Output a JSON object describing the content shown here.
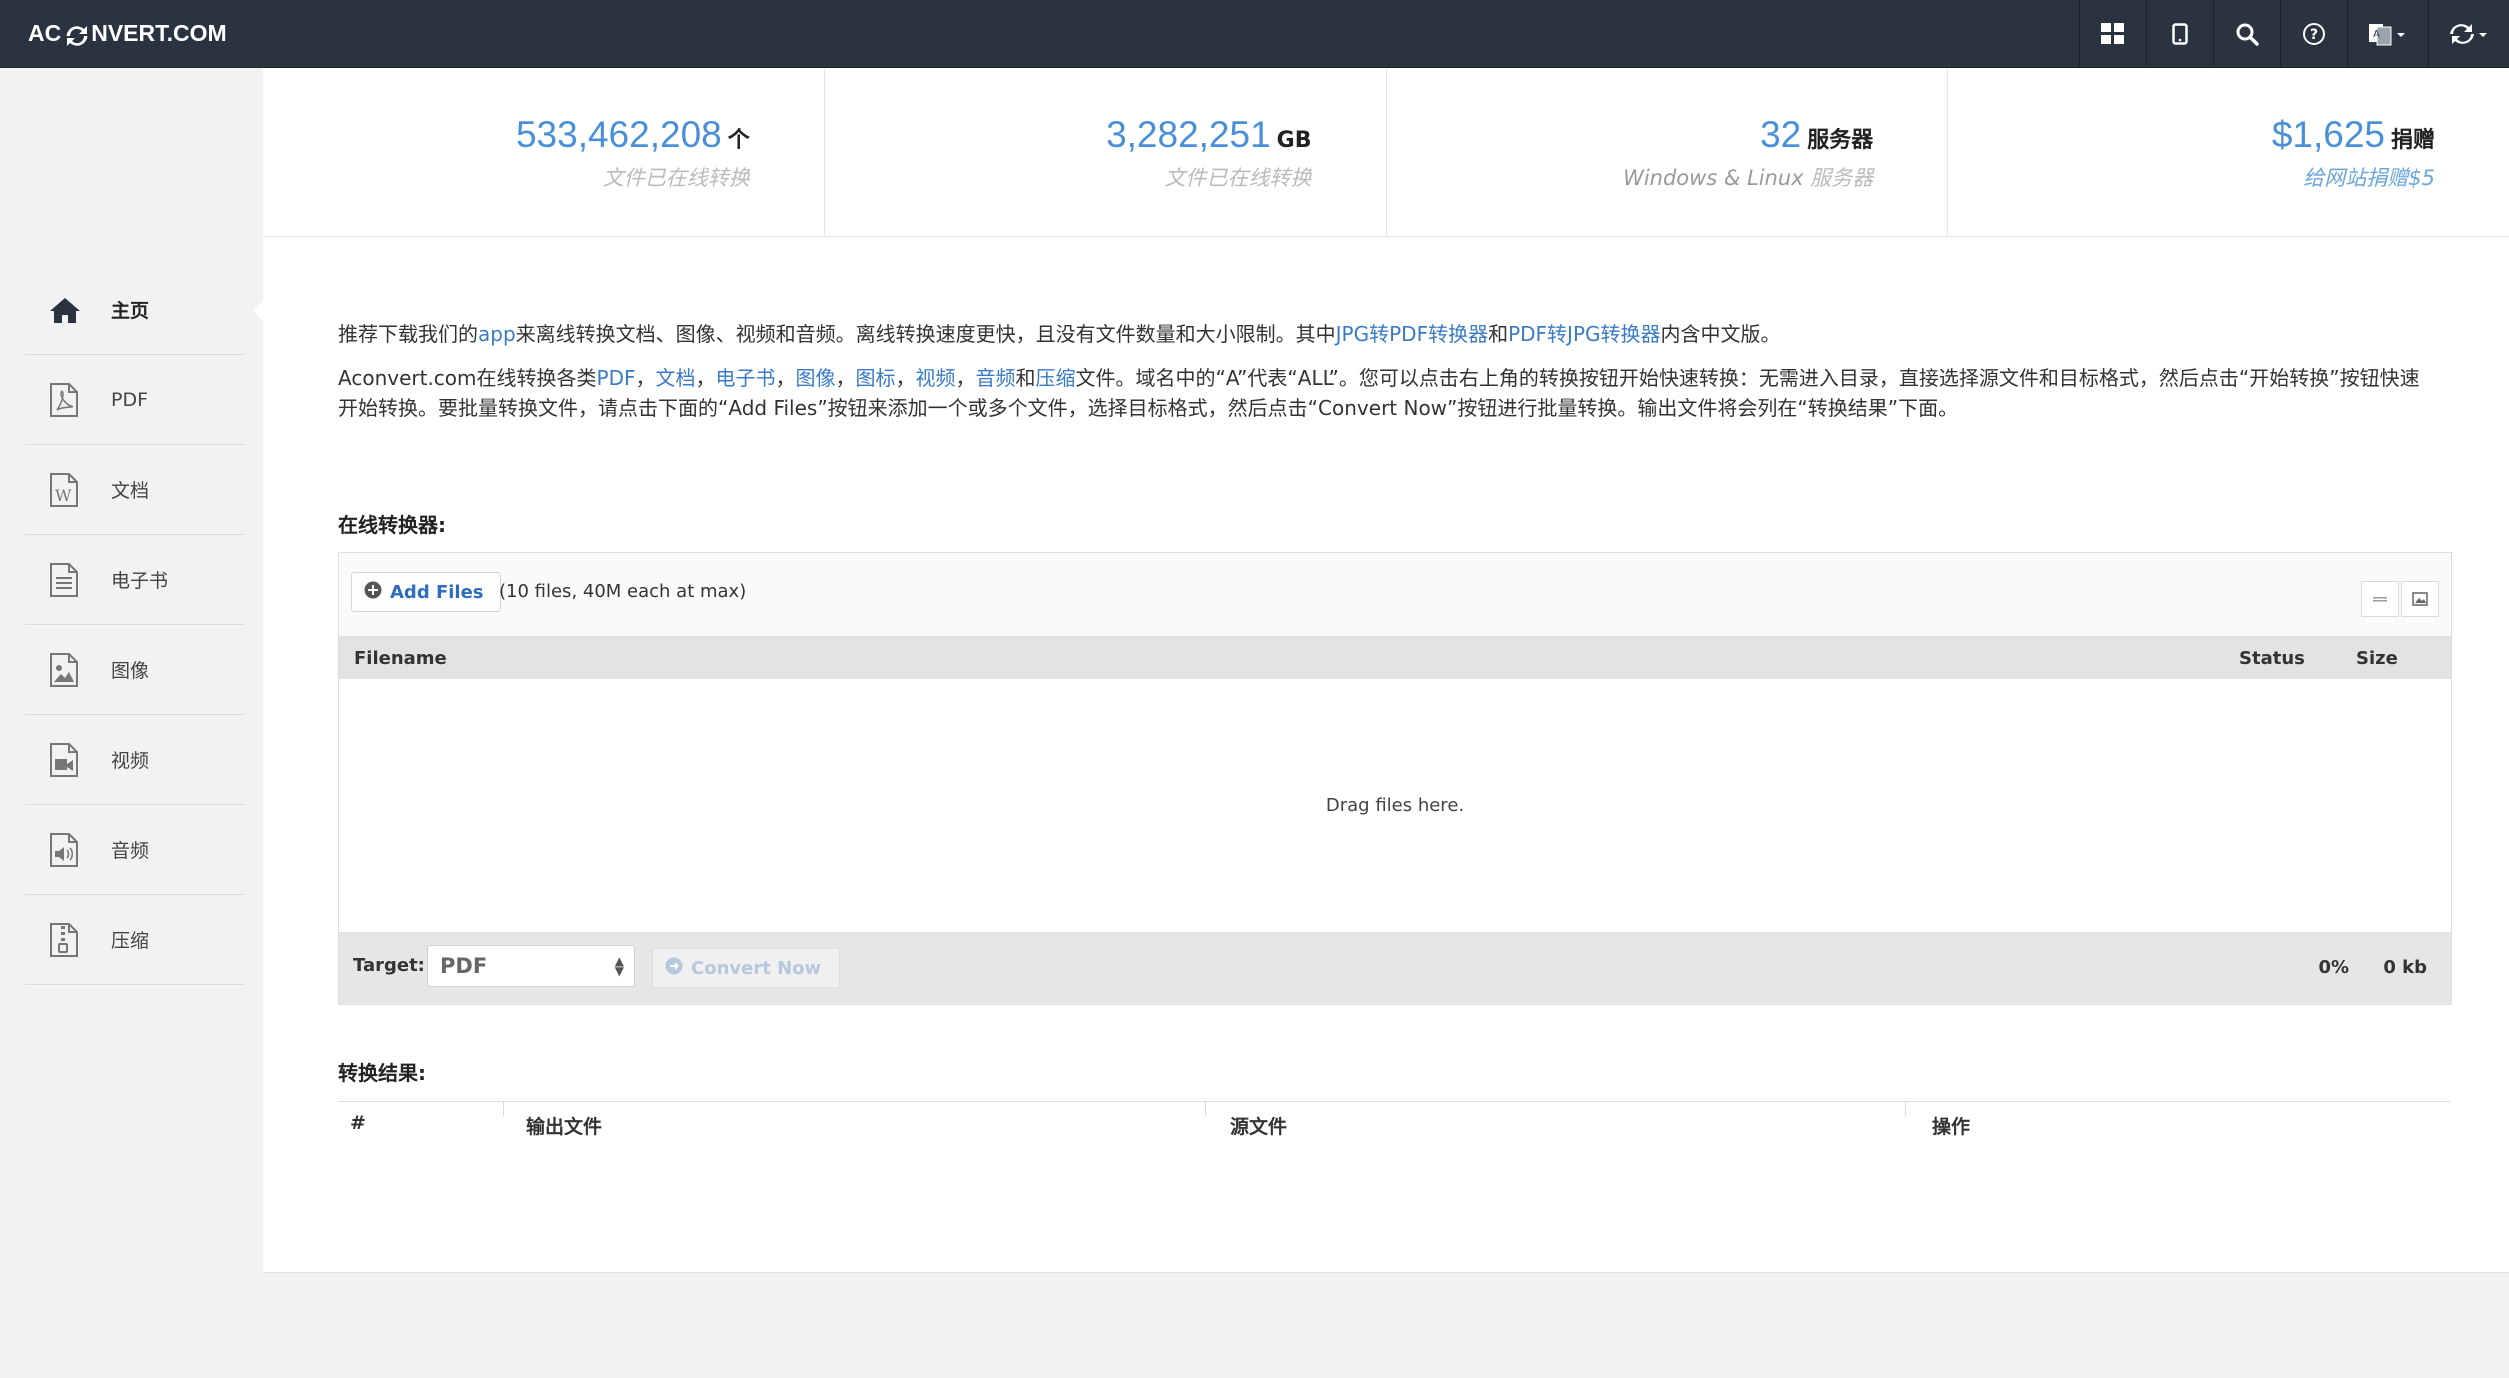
{
  "header": {
    "logo": {
      "left": "AC",
      "right": "NVERT.COM"
    },
    "icons": [
      "apps-grid-icon",
      "mobile-icon",
      "search-icon",
      "help-icon",
      "language-icon",
      "refresh-icon"
    ]
  },
  "sidebar": {
    "items": [
      {
        "label": "主页",
        "icon": "home-icon",
        "active": true
      },
      {
        "label": "PDF",
        "icon": "pdf-file-icon"
      },
      {
        "label": "文档",
        "icon": "word-document-icon"
      },
      {
        "label": "电子书",
        "icon": "ebook-file-icon"
      },
      {
        "label": "图像",
        "icon": "image-file-icon"
      },
      {
        "label": "视频",
        "icon": "video-file-icon"
      },
      {
        "label": "音频",
        "icon": "audio-file-icon"
      },
      {
        "label": "压缩",
        "icon": "archive-file-icon"
      }
    ]
  },
  "stats": [
    {
      "number": "533,462,208",
      "unit": "个",
      "caption": "文件已在线转换"
    },
    {
      "number": "3,282,251",
      "unit": "GB",
      "caption": "文件已在线转换"
    },
    {
      "number": "32",
      "unit": "服务器",
      "caption_a": "Windows & Linux ",
      "caption_b": "服务器"
    },
    {
      "number": "$1,625",
      "unit": "捐赠",
      "caption": "给网站捐赠$5"
    }
  ],
  "intro": {
    "p1": {
      "t1": "推荐下载我们的",
      "link_app": "app",
      "t2": "来离线转换文档、图像、视频和音频。离线转换速度更快，且没有文件数量和大小限制。其中",
      "link_jpg2pdf": "JPG转PDF转换器",
      "t3": "和",
      "link_pdf2jpg": "PDF转JPG转换器",
      "t4": "内含中文版。"
    },
    "p2": {
      "t1": "Aconvert.com在线转换各类",
      "links": [
        "PDF",
        "文档",
        "电子书",
        "图像",
        "图标",
        "视频",
        "音频",
        "压缩"
      ],
      "sep": "，",
      "and": "和",
      "t2": "文件。域名中的“A”代表“ALL”。您可以点击右上角的转换按钮开始快速转换：无需进入目录，直接选择源文件和目标格式，然后点击“开始转换”按钮快速开始转换。要批量转换文件，请点击下面的“Add Files”按钮来添加一个或多个文件，选择目标格式，然后点击“Convert Now”按钮进行批量转换。输出文件将会列在“转换结果”下面。"
    }
  },
  "converter": {
    "title": "在线转换器:",
    "add_files": "Add Files",
    "limit_note": "(10 files, 40M each at max)",
    "columns": {
      "filename": "Filename",
      "status": "Status",
      "size": "Size"
    },
    "drop_text": "Drag files here.",
    "target_label": "Target:",
    "target_value": "PDF",
    "convert_now": "Convert Now",
    "progress": "0%",
    "total_size": "0 kb"
  },
  "results": {
    "title": "转换结果:",
    "columns": [
      "#",
      "输出文件",
      "源文件",
      "操作"
    ]
  }
}
